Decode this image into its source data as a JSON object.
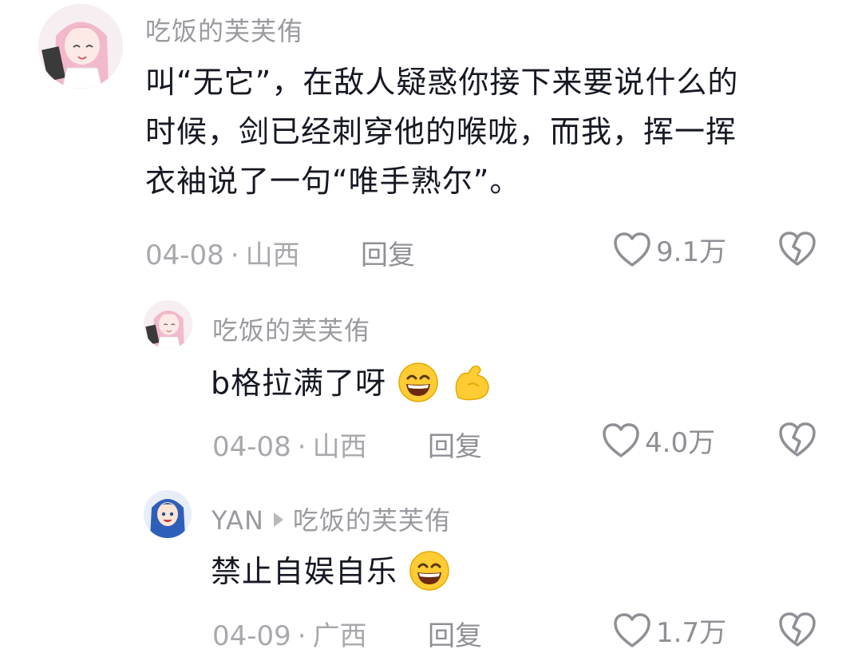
{
  "comments": [
    {
      "username": "吃饭的芙芙侑",
      "reply_to": "",
      "text_lines": [
        "叫“无它”，在敌人疑惑你接下来要说什么的",
        "时候，剑已经刺穿他的喉咙，而我，挥一挥",
        "衣袖说了一句“唯手熟尔”。"
      ],
      "date": "04-08",
      "separator": "·",
      "location": "山西",
      "reply_label": "回复",
      "likes": "9.1万",
      "avatar_icon": "anime-girl-pink-hair-avatar"
    },
    {
      "username": "吃饭的芙芙侑",
      "reply_to": "",
      "text": "b格拉满了呀",
      "emojis": [
        "grinning-face-icon",
        "flexed-biceps-icon"
      ],
      "date": "04-08",
      "separator": "·",
      "location": "山西",
      "reply_label": "回复",
      "likes": "4.0万",
      "avatar_icon": "anime-girl-pink-hair-avatar"
    },
    {
      "username": "YAN",
      "reply_to": "吃饭的芙芙侑",
      "text": "禁止自娱自乐",
      "emojis": [
        "grinning-face-icon"
      ],
      "date": "04-09",
      "separator": "·",
      "location": "广西",
      "reply_label": "回复",
      "likes": "1.7万",
      "avatar_icon": "anime-girl-blue-hair-avatar"
    }
  ],
  "colors": {
    "username": "#9a9ba0",
    "text": "#161823",
    "meta": "#a8a9ad",
    "icon": "#8f9096"
  }
}
